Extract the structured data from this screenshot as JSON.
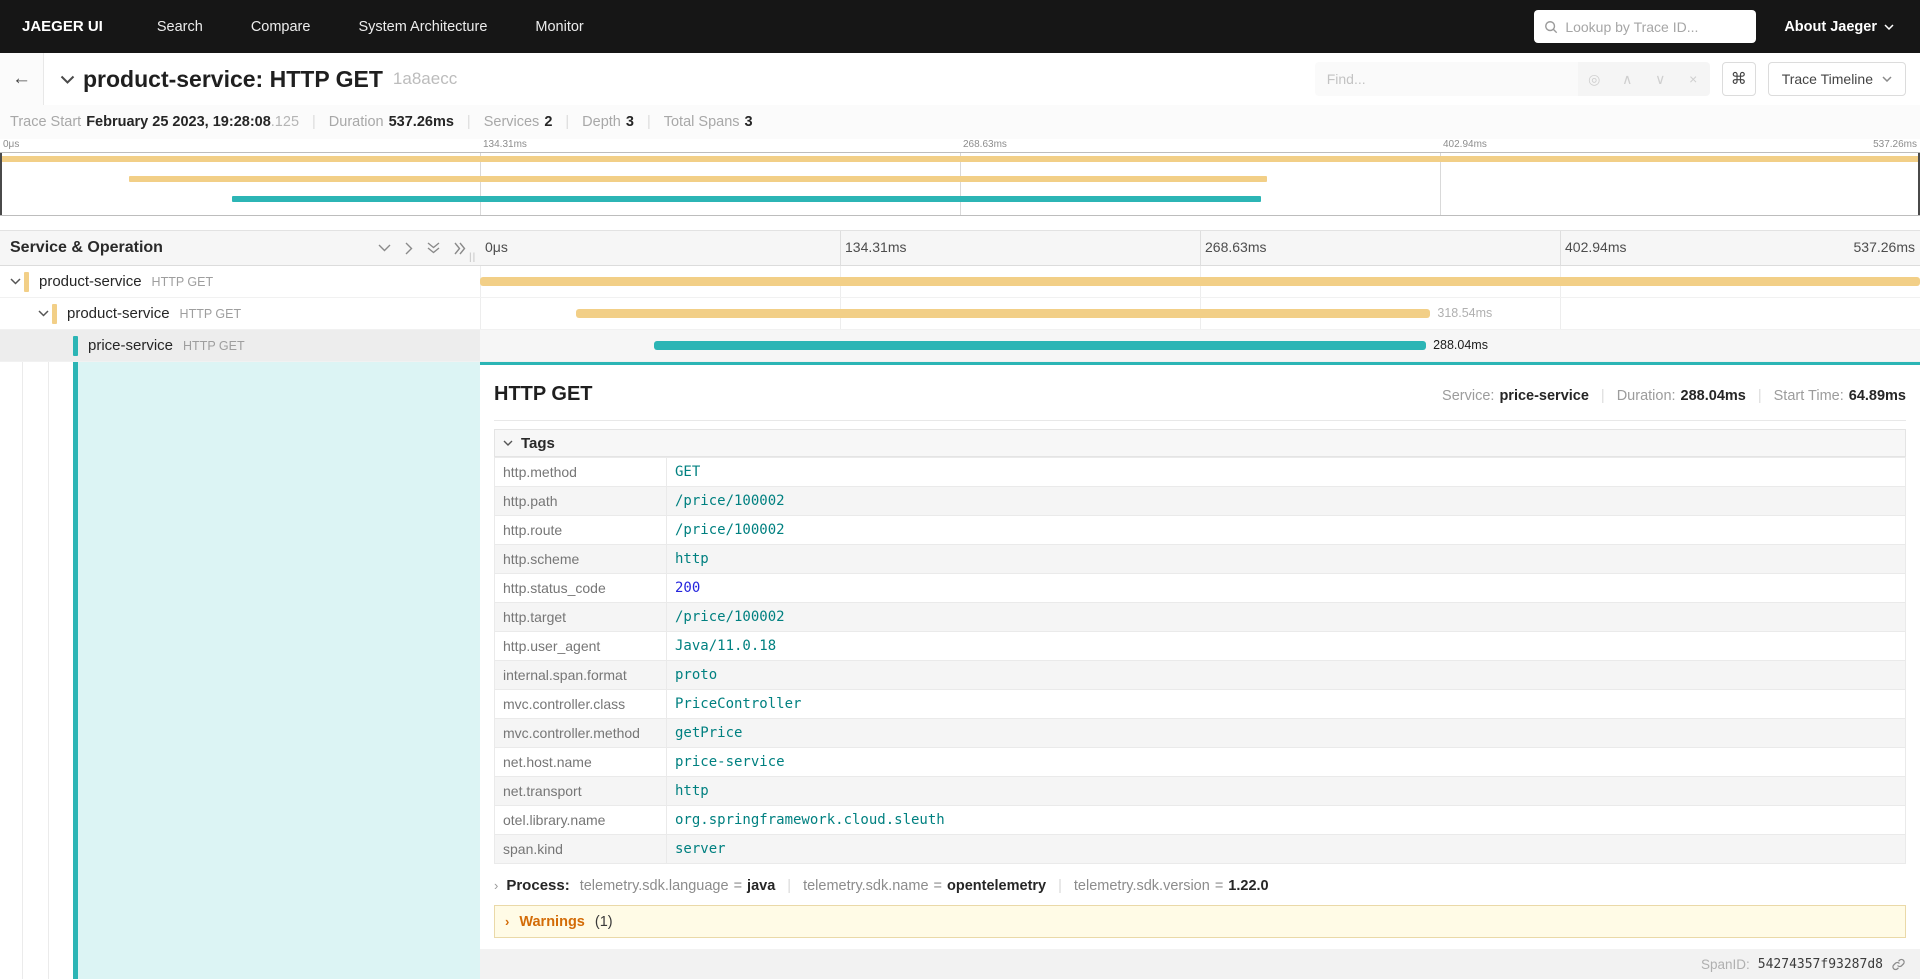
{
  "nav": {
    "brand": "JAEGER UI",
    "items": [
      "Search",
      "Compare",
      "System Architecture",
      "Monitor"
    ],
    "lookup_placeholder": "Lookup by Trace ID...",
    "about_label": "About Jaeger"
  },
  "trace_header": {
    "title": "product-service: HTTP GET",
    "trace_id_short": "1a8aecc",
    "find_placeholder": "Find...",
    "shortcut_key": "⌘",
    "view_selector_label": "Trace Timeline"
  },
  "summary": {
    "trace_start_label": "Trace Start",
    "trace_start_value": "February 25 2023, 19:28:08",
    "trace_start_fraction": ".125",
    "duration_label": "Duration",
    "duration_value": "537.26ms",
    "services_label": "Services",
    "services_value": "2",
    "depth_label": "Depth",
    "depth_value": "3",
    "total_spans_label": "Total Spans",
    "total_spans_value": "3"
  },
  "ticks": [
    "0μs",
    "134.31ms",
    "268.63ms",
    "402.94ms",
    "537.26ms"
  ],
  "timeline": {
    "header_left": "Service & Operation",
    "spans": [
      {
        "service": "product-service",
        "operation": "HTTP GET",
        "color": "#f2cf87",
        "start_pct": 0,
        "width_pct": 100,
        "duration_label": "",
        "selected": false
      },
      {
        "service": "product-service",
        "operation": "HTTP GET",
        "color": "#f2cf87",
        "start_pct": 6.7,
        "width_pct": 59.3,
        "duration_label": "318.54ms",
        "selected": false
      },
      {
        "service": "price-service",
        "operation": "HTTP GET",
        "color": "#2cb5b5",
        "start_pct": 12.1,
        "width_pct": 53.6,
        "duration_label": "288.04ms",
        "selected": true
      }
    ]
  },
  "detail": {
    "title": "HTTP GET",
    "service_label": "Service:",
    "service_value": "price-service",
    "duration_label": "Duration:",
    "duration_value": "288.04ms",
    "start_label": "Start Time:",
    "start_value": "64.89ms",
    "tags_label": "Tags",
    "tags": [
      {
        "key": "http.method",
        "value": "GET",
        "type": "string"
      },
      {
        "key": "http.path",
        "value": "/price/100002",
        "type": "string"
      },
      {
        "key": "http.route",
        "value": "/price/100002",
        "type": "string"
      },
      {
        "key": "http.scheme",
        "value": "http",
        "type": "string"
      },
      {
        "key": "http.status_code",
        "value": "200",
        "type": "number"
      },
      {
        "key": "http.target",
        "value": "/price/100002",
        "type": "string"
      },
      {
        "key": "http.user_agent",
        "value": "Java/11.0.18",
        "type": "string"
      },
      {
        "key": "internal.span.format",
        "value": "proto",
        "type": "string"
      },
      {
        "key": "mvc.controller.class",
        "value": "PriceController",
        "type": "string"
      },
      {
        "key": "mvc.controller.method",
        "value": "getPrice",
        "type": "string"
      },
      {
        "key": "net.host.name",
        "value": "price-service",
        "type": "string"
      },
      {
        "key": "net.transport",
        "value": "http",
        "type": "string"
      },
      {
        "key": "otel.library.name",
        "value": "org.springframework.cloud.sleuth",
        "type": "string"
      },
      {
        "key": "span.kind",
        "value": "server",
        "type": "string"
      }
    ],
    "process_label": "Process:",
    "process": [
      {
        "key": "telemetry.sdk.language",
        "value": "java"
      },
      {
        "key": "telemetry.sdk.name",
        "value": "opentelemetry"
      },
      {
        "key": "telemetry.sdk.version",
        "value": "1.22.0"
      }
    ],
    "warnings_label": "Warnings",
    "warnings_count": "(1)",
    "span_id_label": "SpanID:",
    "span_id_value": "54274357f93287d8"
  },
  "colors": {
    "accent_teal": "#2cb5b5",
    "span_yellow": "#f2cf87",
    "selected_bg_cyan": "#dcf4f4",
    "warning_orange": "#d36c08",
    "value_teal": "#008080",
    "value_blue": "#2525dd"
  }
}
